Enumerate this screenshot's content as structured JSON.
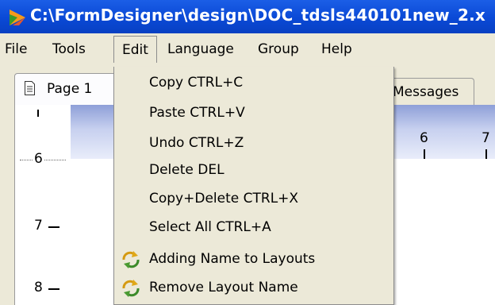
{
  "window": {
    "title": "C:\\FormDesigner\\design\\DOC_tdsls440101new_2.x"
  },
  "menubar": {
    "items": [
      {
        "label": "File"
      },
      {
        "label": "Tools"
      },
      {
        "label": "Edit"
      },
      {
        "label": "Language"
      },
      {
        "label": "Group"
      },
      {
        "label": "Help"
      }
    ]
  },
  "tabs": {
    "page1": "Page 1",
    "messages": "Messages"
  },
  "rulers": {
    "horizontal": [
      "6",
      "7"
    ],
    "vertical": [
      "6",
      "7",
      "8"
    ]
  },
  "edit_menu": {
    "items": [
      {
        "label": "Copy CTRL+C"
      },
      {
        "label": "Paste CTRL+V"
      },
      {
        "label": "Undo CTRL+Z"
      },
      {
        "label": "Delete DEL"
      },
      {
        "label": "Copy+Delete CTRL+X"
      },
      {
        "label": "Select All CTRL+A"
      },
      {
        "label": "Adding Name to Layouts",
        "icon": "refresh-icon"
      },
      {
        "label": "Remove Layout Name",
        "icon": "refresh-icon"
      }
    ]
  },
  "colors": {
    "titlebar": "#0a49d6",
    "menu_background": "#ece9d8",
    "ruler_gradient": "#8e9fd8"
  }
}
